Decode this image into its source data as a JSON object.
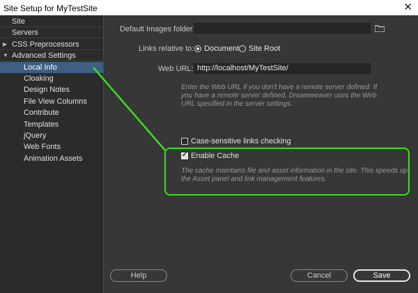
{
  "window": {
    "title": "Site Setup for MyTestSite",
    "close_glyph": "✕"
  },
  "sidebar": {
    "items": [
      {
        "label": "Site",
        "level": 0
      },
      {
        "label": "Servers",
        "level": 0
      },
      {
        "label": "CSS Preprocessors",
        "level": 0,
        "arrow": "▶"
      },
      {
        "label": "Advanced Settings",
        "level": 0,
        "arrow": "▼"
      },
      {
        "label": "Local Info",
        "level": 1,
        "selected": true
      },
      {
        "label": "Cloaking",
        "level": 1
      },
      {
        "label": "Design Notes",
        "level": 1
      },
      {
        "label": "File View Columns",
        "level": 1
      },
      {
        "label": "Contribute",
        "level": 1
      },
      {
        "label": "Templates",
        "level": 1
      },
      {
        "label": "jQuery",
        "level": 1
      },
      {
        "label": "Web Fonts",
        "level": 1
      },
      {
        "label": "Animation Assets",
        "level": 1
      }
    ]
  },
  "form": {
    "images_folder_label": "Default Images folder:",
    "images_folder_value": "",
    "links_relative_label": "Links relative to:",
    "radio_document": "Document",
    "radio_site_root": "Site Root",
    "web_url_label": "Web URL:",
    "web_url_value": "http://localhost/MyTestSite/",
    "web_url_help": [
      "Enter the Web URL if you don't have a remote server defined. If",
      "you have a remote server defined, Dreamweaver uses the Web",
      "URL specified in the server settings."
    ],
    "case_sensitive_label": "Case-sensitive links checking",
    "case_sensitive_checked": false,
    "enable_cache_label": "Enable Cache",
    "enable_cache_checked": true,
    "cache_help": [
      "The cache maintains file and asset information in the site. This speeds up",
      "the Asset panel and link management features."
    ]
  },
  "buttons": {
    "help": "Help",
    "cancel": "Cancel",
    "save": "Save"
  },
  "colors": {
    "annotation": "#39e01a",
    "selected": "#3e5f82"
  }
}
